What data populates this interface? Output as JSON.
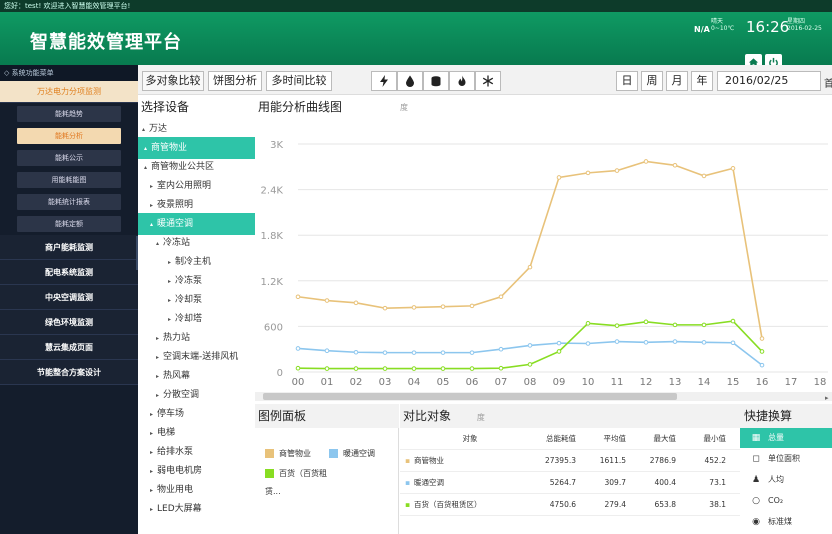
{
  "topbar": {
    "welcome": "您好：test! 欢迎进入智慧能效管理平台!"
  },
  "header": {
    "title": "智慧能效管理平台",
    "na": "N/A",
    "weather_lines": [
      "晴天",
      "0~10℃"
    ],
    "time": "16:26",
    "date_lines": [
      "星期四",
      "2016-02-25"
    ]
  },
  "sidebar": {
    "title": "◇ 系统功能菜单",
    "items": [
      {
        "label": "万达电力分项监测",
        "level": 1,
        "active": true
      },
      {
        "label": "能耗趋势",
        "level": 2
      },
      {
        "label": "能耗分析",
        "level": 2,
        "active": true
      },
      {
        "label": "能耗公示",
        "level": 2
      },
      {
        "label": "用能耗能图",
        "level": 2
      },
      {
        "label": "能耗统计报表",
        "level": 2
      },
      {
        "label": "能耗定额",
        "level": 2
      },
      {
        "label": "商户能耗监测",
        "level": 1
      },
      {
        "label": "配电系统监测",
        "level": 1
      },
      {
        "label": "中央空调监测",
        "level": 1
      },
      {
        "label": "绿色环境监测",
        "level": 1
      },
      {
        "label": "慧云集成页面",
        "level": 1
      },
      {
        "label": "节能整合方案设计",
        "level": 1
      }
    ]
  },
  "toolbar": {
    "tabs": [
      "多对象比较",
      "饼图分析",
      "多时间比较"
    ],
    "energy_icons": [
      "lightning-icon",
      "water-drop-icon",
      "gas-cylinder-icon",
      "flame-icon",
      "snowflake-icon"
    ],
    "period_buttons": [
      "日",
      "周",
      "月",
      "年"
    ],
    "date_value": "2016/02/25",
    "date_suffix": "首"
  },
  "select_device": {
    "title": "选择设备"
  },
  "tree": [
    {
      "label": "万达",
      "indent": 0,
      "tri": "▴"
    },
    {
      "label": "商管物业",
      "indent": 1,
      "tri": "▴",
      "selected": true
    },
    {
      "label": "商管物业公共区",
      "indent": 1,
      "tri": "▴"
    },
    {
      "label": "室内公用照明",
      "indent": 2,
      "tri": "▸"
    },
    {
      "label": "夜景照明",
      "indent": 2,
      "tri": "▸"
    },
    {
      "label": "暖通空调",
      "indent": 2,
      "tri": "▴",
      "selected": true
    },
    {
      "label": "冷冻站",
      "indent": 3,
      "tri": "▴"
    },
    {
      "label": "制冷主机",
      "indent": 4,
      "tri": "▸"
    },
    {
      "label": "冷冻泵",
      "indent": 4,
      "tri": "▸"
    },
    {
      "label": "冷却泵",
      "indent": 4,
      "tri": "▸"
    },
    {
      "label": "冷却塔",
      "indent": 4,
      "tri": "▸"
    },
    {
      "label": "热力站",
      "indent": 3,
      "tri": "▸"
    },
    {
      "label": "空调末端-送排风机",
      "indent": 3,
      "tri": "▸"
    },
    {
      "label": "热风幕",
      "indent": 3,
      "tri": "▸"
    },
    {
      "label": "分散空调",
      "indent": 3,
      "tri": "▸"
    },
    {
      "label": "停车场",
      "indent": 2,
      "tri": "▸"
    },
    {
      "label": "电梯",
      "indent": 2,
      "tri": "▸"
    },
    {
      "label": "给排水泵",
      "indent": 2,
      "tri": "▸"
    },
    {
      "label": "弱电电机房",
      "indent": 2,
      "tri": "▸"
    },
    {
      "label": "物业用电",
      "indent": 2,
      "tri": "▸"
    },
    {
      "label": "LED大屏幕",
      "indent": 2,
      "tri": "▸"
    }
  ],
  "chart_section": {
    "title": "用能分析曲线图",
    "unit": "度"
  },
  "chart_data": {
    "type": "line",
    "x": [
      "00",
      "01",
      "02",
      "03",
      "04",
      "05",
      "06",
      "07",
      "08",
      "09",
      "10",
      "11",
      "12",
      "13",
      "14",
      "15",
      "16",
      "17",
      "18"
    ],
    "yticks": [
      "0",
      "600",
      "1.2K",
      "1.8K",
      "2.4K",
      "3K"
    ],
    "ylim": [
      0,
      3000
    ],
    "grid": true,
    "series": [
      {
        "name": "商管物业",
        "color": "#e8c27a",
        "values": [
          990,
          940,
          910,
          840,
          850,
          860,
          870,
          990,
          1380,
          2560,
          2620,
          2650,
          2770,
          2720,
          2580,
          2680,
          440
        ]
      },
      {
        "name": "暖通空调",
        "color": "#8cc6ee",
        "values": [
          310,
          280,
          260,
          255,
          255,
          255,
          255,
          300,
          350,
          380,
          375,
          400,
          390,
          400,
          390,
          385,
          90
        ]
      },
      {
        "name": "百货（百货租赁区）",
        "color": "#88dd22",
        "values": [
          50,
          45,
          45,
          45,
          45,
          45,
          45,
          50,
          100,
          270,
          640,
          610,
          660,
          620,
          620,
          670,
          270
        ]
      }
    ]
  },
  "legend_section": {
    "title": "图例面板",
    "items": [
      "商管物业",
      "暖通空调",
      "百货（百货租",
      "赁..."
    ]
  },
  "compare_section": {
    "title": "对比对象",
    "unit": "度",
    "headers": [
      "对象",
      "总能耗值",
      "平均值",
      "最大值",
      "最小值"
    ],
    "rows": [
      [
        "商管物业",
        "27395.3",
        "1611.5",
        "2786.9",
        "452.2"
      ],
      [
        "暖通空调",
        "5264.7",
        "309.7",
        "400.4",
        "73.1"
      ],
      [
        "百货（百货租赁区）",
        "4750.6",
        "279.4",
        "653.8",
        "38.1"
      ]
    ],
    "row_colors": [
      "#e8c27a",
      "#8cc6ee",
      "#88dd22"
    ]
  },
  "quick_section": {
    "title": "快捷换算",
    "items": [
      {
        "label": "总量",
        "icon": "grid-icon",
        "glyph": "▦"
      },
      {
        "label": "单位面积",
        "icon": "area-icon",
        "glyph": "◻"
      },
      {
        "label": "人均",
        "icon": "person-icon",
        "glyph": "♟"
      },
      {
        "label": "CO₂",
        "icon": "co2-icon",
        "glyph": "○"
      },
      {
        "label": "标准煤",
        "icon": "coal-icon",
        "glyph": "◉"
      }
    ]
  }
}
